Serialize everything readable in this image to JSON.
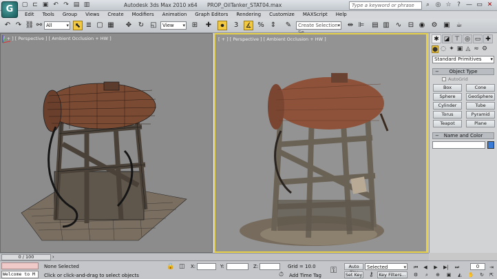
{
  "window": {
    "app_title": "Autodesk 3ds Max 2010 x64",
    "file_name": "PROP_OilTanker_STAT04.max",
    "search_placeholder": "Type a keyword or phrase"
  },
  "menu": [
    "Edit",
    "Tools",
    "Group",
    "Views",
    "Create",
    "Modifiers",
    "Animation",
    "Graph Editors",
    "Rendering",
    "Customize",
    "MAXScript",
    "Help"
  ],
  "toolbar": {
    "selection_filter": "All",
    "reference_coord": "View",
    "named_selection_placeholder": "Create Selection Se"
  },
  "viewports": {
    "left_label": "[ + ] [ Perspective ] [ Ambient Occlusion + HW ]",
    "right_label": "[ + ] [ Perspective ] [ Ambient Occlusion + HW ]"
  },
  "command_panel": {
    "category": "Standard Primitives",
    "object_type_title": "Object Type",
    "autogrid_label": "AutoGrid",
    "buttons": [
      "Box",
      "Cone",
      "Sphere",
      "GeoSphere",
      "Cylinder",
      "Tube",
      "Torus",
      "Pyramid",
      "Teapot",
      "Plane"
    ],
    "name_color_title": "Name and Color"
  },
  "timeline": {
    "frame_range": "0 / 100"
  },
  "status": {
    "maxscript_listener": "Welcome to M",
    "selection_info": "None Selected",
    "prompt": "Click or click-and-drag to select objects",
    "x_label": "X:",
    "y_label": "Y:",
    "z_label": "Z:",
    "grid": "Grid = 10.0",
    "add_time_tag": "Add Time Tag",
    "auto_key": "Auto Key",
    "set_key": "Set Key",
    "key_mode": "Selected",
    "key_filters": "Key Filters...",
    "current_frame": "0"
  },
  "colors": {
    "viewport_bg": "#8c8c8c",
    "active_viewport_border": "#e8d24a",
    "active_tool": "#f2c940",
    "object_color": "#3a7bd5"
  }
}
